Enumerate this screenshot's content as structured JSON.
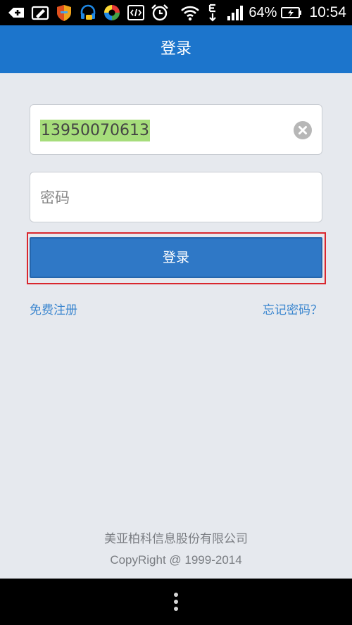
{
  "status_bar": {
    "icons": [
      "add-icon",
      "edit-icon",
      "shield-icon",
      "headset-icon",
      "ball-icon",
      "code-icon",
      "alarm-icon",
      "wifi-icon",
      "e-signal-icon",
      "signal-bars-icon",
      "battery-charging-icon"
    ],
    "battery_percent": "64%",
    "time": "10:54"
  },
  "header": {
    "title": "登录"
  },
  "form": {
    "phone_value": "13950070613",
    "password_placeholder": "密码",
    "login_label": "登录"
  },
  "links": {
    "register": "免费注册",
    "forgot": "忘记密码？"
  },
  "footer": {
    "company": "美亚柏科信息股份有限公司",
    "copyright": "CopyRight @ 1999-2014"
  },
  "colors": {
    "header_bg": "#1c75cc",
    "button_bg": "#2f78c6",
    "link": "#3b86cf",
    "highlight": "#a6dd7b",
    "focus_border": "#d9272e"
  }
}
